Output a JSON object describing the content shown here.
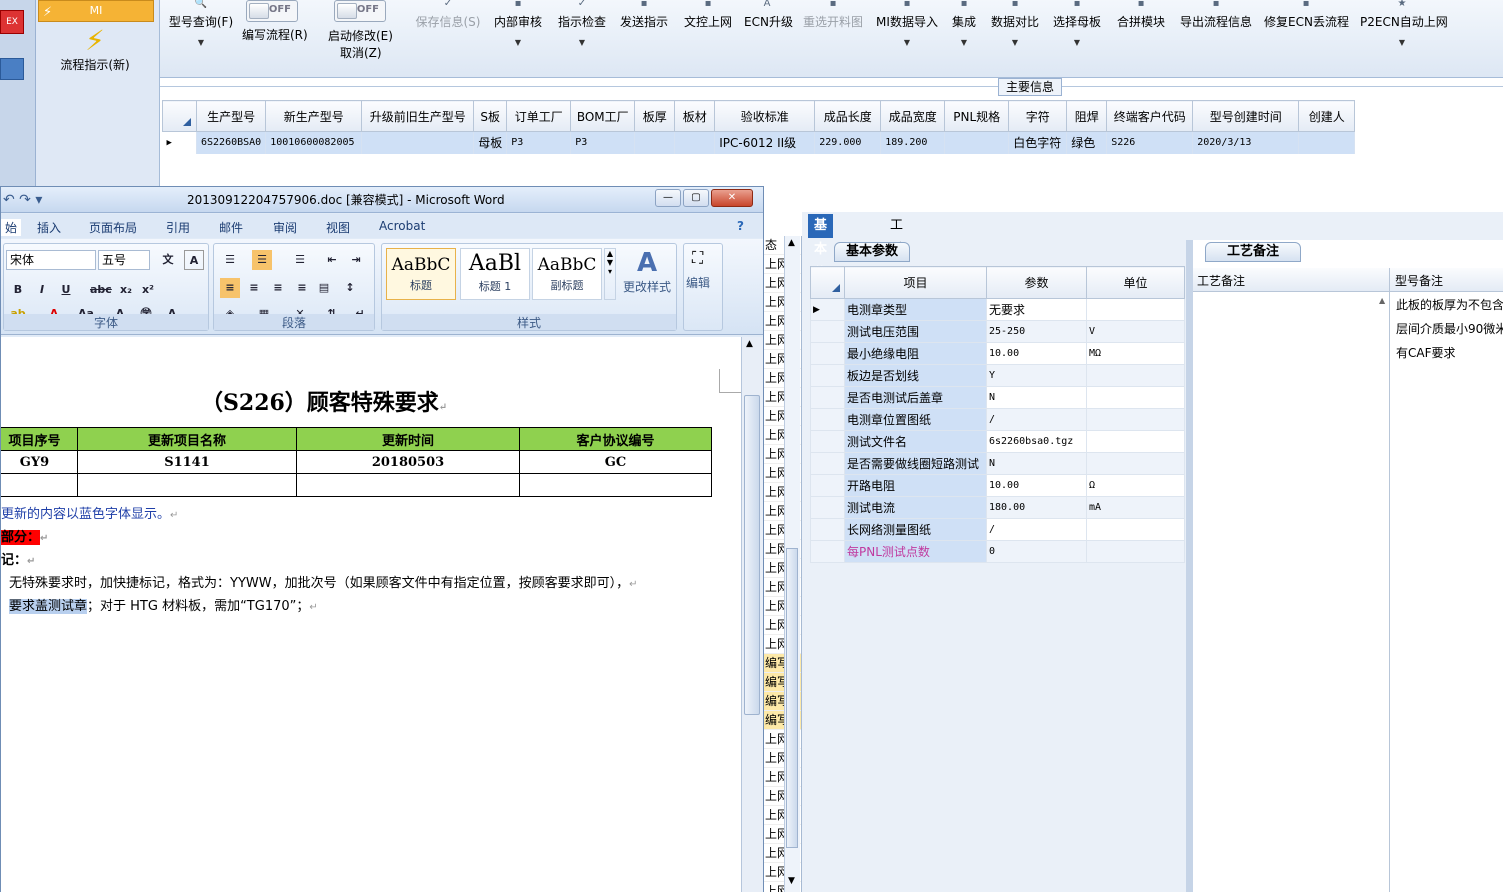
{
  "left_nav": {
    "mi_label": "MI",
    "flow_label": "流程指示(新)"
  },
  "toolbar": {
    "query_label": "型号查询(F)",
    "edit_flow_toggle": "OFF",
    "edit_flow_label": "编写流程(R)",
    "start_modify_toggle": "OFF",
    "start_modify_label": "启动修改(E)",
    "cancel_label": "取消(Z)",
    "save_label": "保存信息(S)",
    "items": [
      "内部审核",
      "指示检查",
      "发送指示",
      "文控上网",
      "ECN升级",
      "重选开料图",
      "MI数据导入",
      "集成",
      "数据对比",
      "选择母板",
      "合拼模块",
      "导出流程信息",
      "修复ECN丢流程",
      "P2ECN自动上网"
    ]
  },
  "main_info": {
    "title": "主要信息",
    "columns": [
      "生产型号",
      "新生产型号",
      "升级前旧生产型号",
      "S板",
      "订单工厂",
      "BOM工厂",
      "板厚",
      "板材",
      "验收标准",
      "成品长度",
      "成品宽度",
      "PNL规格",
      "字符",
      "阻焊",
      "终端客户代码",
      "型号创建时间",
      "创建人"
    ],
    "row": [
      "6S2260BSA0",
      "10010600082005",
      "",
      "母板",
      "P3",
      "P3",
      "",
      "",
      "IPC-6012 II级",
      "229.000",
      "189.200",
      "",
      "白色字符",
      "绿色",
      "S226",
      "2020/3/13",
      ""
    ]
  },
  "word": {
    "title": "20130912204757906.doc [兼容模式] - Microsoft Word",
    "tabs": [
      "始",
      "插入",
      "页面布局",
      "引用",
      "邮件",
      "审阅",
      "视图",
      "Acrobat"
    ],
    "font_name": "宋体",
    "font_size": "五号",
    "group_font": "字体",
    "group_para": "段落",
    "group_style": "样式",
    "styles": [
      {
        "preview": "AaBbC",
        "name": "标题"
      },
      {
        "preview": "AaBl",
        "name": "标题 1"
      },
      {
        "preview": "AaBbC",
        "name": "副标题"
      }
    ],
    "change_style": "更改样式",
    "edit_label": "编辑",
    "doc_title": "（S226）顾客特殊要求",
    "table_headers": [
      "项目序号",
      "更新项目名称",
      "更新时间",
      "客户协议编号"
    ],
    "table_rows": [
      [
        "GY9",
        "S1141",
        "20180503",
        "GC"
      ],
      [
        "",
        "",
        "",
        ""
      ]
    ],
    "line1": "更新的内容以蓝色字体显示。",
    "line2": "部分：",
    "line3": "记：",
    "line4": "无特殊要求时，加快捷标记，格式为：YYWW，加批次号（如果顾客文件中有指定位置，按顾客要求即可），",
    "line5_highlight": "要求盖测试章",
    "line5_rest": "；对于 HTG 材料板，需加“TG170”；"
  },
  "mid_list": {
    "top": "态",
    "items": [
      "上网",
      "上网",
      "上网",
      "上网",
      "上网",
      "上网",
      "上网",
      "上网",
      "上网",
      "上网",
      "上网",
      "上网",
      "上网",
      "上网",
      "上网",
      "上网",
      "上网",
      "上网",
      "上网",
      "上网",
      "上网",
      "编写",
      "编写",
      "编写",
      "编写",
      "上网",
      "上网",
      "上网",
      "上网",
      "上网",
      "上网",
      "上网",
      "上网",
      "上网"
    ]
  },
  "right_panel": {
    "tabs": [
      "基本信息",
      "工时"
    ],
    "subtab_basic": "基本参数",
    "subtab_craft": "工艺备注",
    "param_headers": [
      "项目",
      "参数",
      "单位"
    ],
    "params": [
      {
        "name": "电测章类型",
        "value": "无要求",
        "unit": ""
      },
      {
        "name": "测试电压范围",
        "value": "25-250",
        "unit": "V"
      },
      {
        "name": "最小绝缘电阻",
        "value": "10.00",
        "unit": "MΩ"
      },
      {
        "name": "板边是否划线",
        "value": "Y",
        "unit": ""
      },
      {
        "name": "是否电测试后盖章",
        "value": "N",
        "unit": ""
      },
      {
        "name": "电测章位置图纸",
        "value": "/",
        "unit": ""
      },
      {
        "name": "测试文件名",
        "value": "6s2260bsa0.tgz",
        "unit": ""
      },
      {
        "name": "是否需要做线圈短路测试",
        "value": "N",
        "unit": ""
      },
      {
        "name": "开路电阻",
        "value": "10.00",
        "unit": "Ω"
      },
      {
        "name": "测试电流",
        "value": "180.00",
        "unit": "mA"
      },
      {
        "name": "长网络测量图纸",
        "value": "/",
        "unit": ""
      },
      {
        "name": "每PNL测试点数",
        "value": "0",
        "unit": ""
      }
    ],
    "craft_header_1": "工艺备注",
    "craft_header_2": "型号备注",
    "craft_notes": [
      "此板的板厚为不包含",
      "层间介质最小90微米",
      "有CAF要求"
    ]
  },
  "colors": {
    "accent": "#2a68b8",
    "header_green": "#8fd14f",
    "selected_row": "#cfe0f6",
    "red_highlight": "#ff0000",
    "doc_blue_text": "#1f3fa8"
  }
}
